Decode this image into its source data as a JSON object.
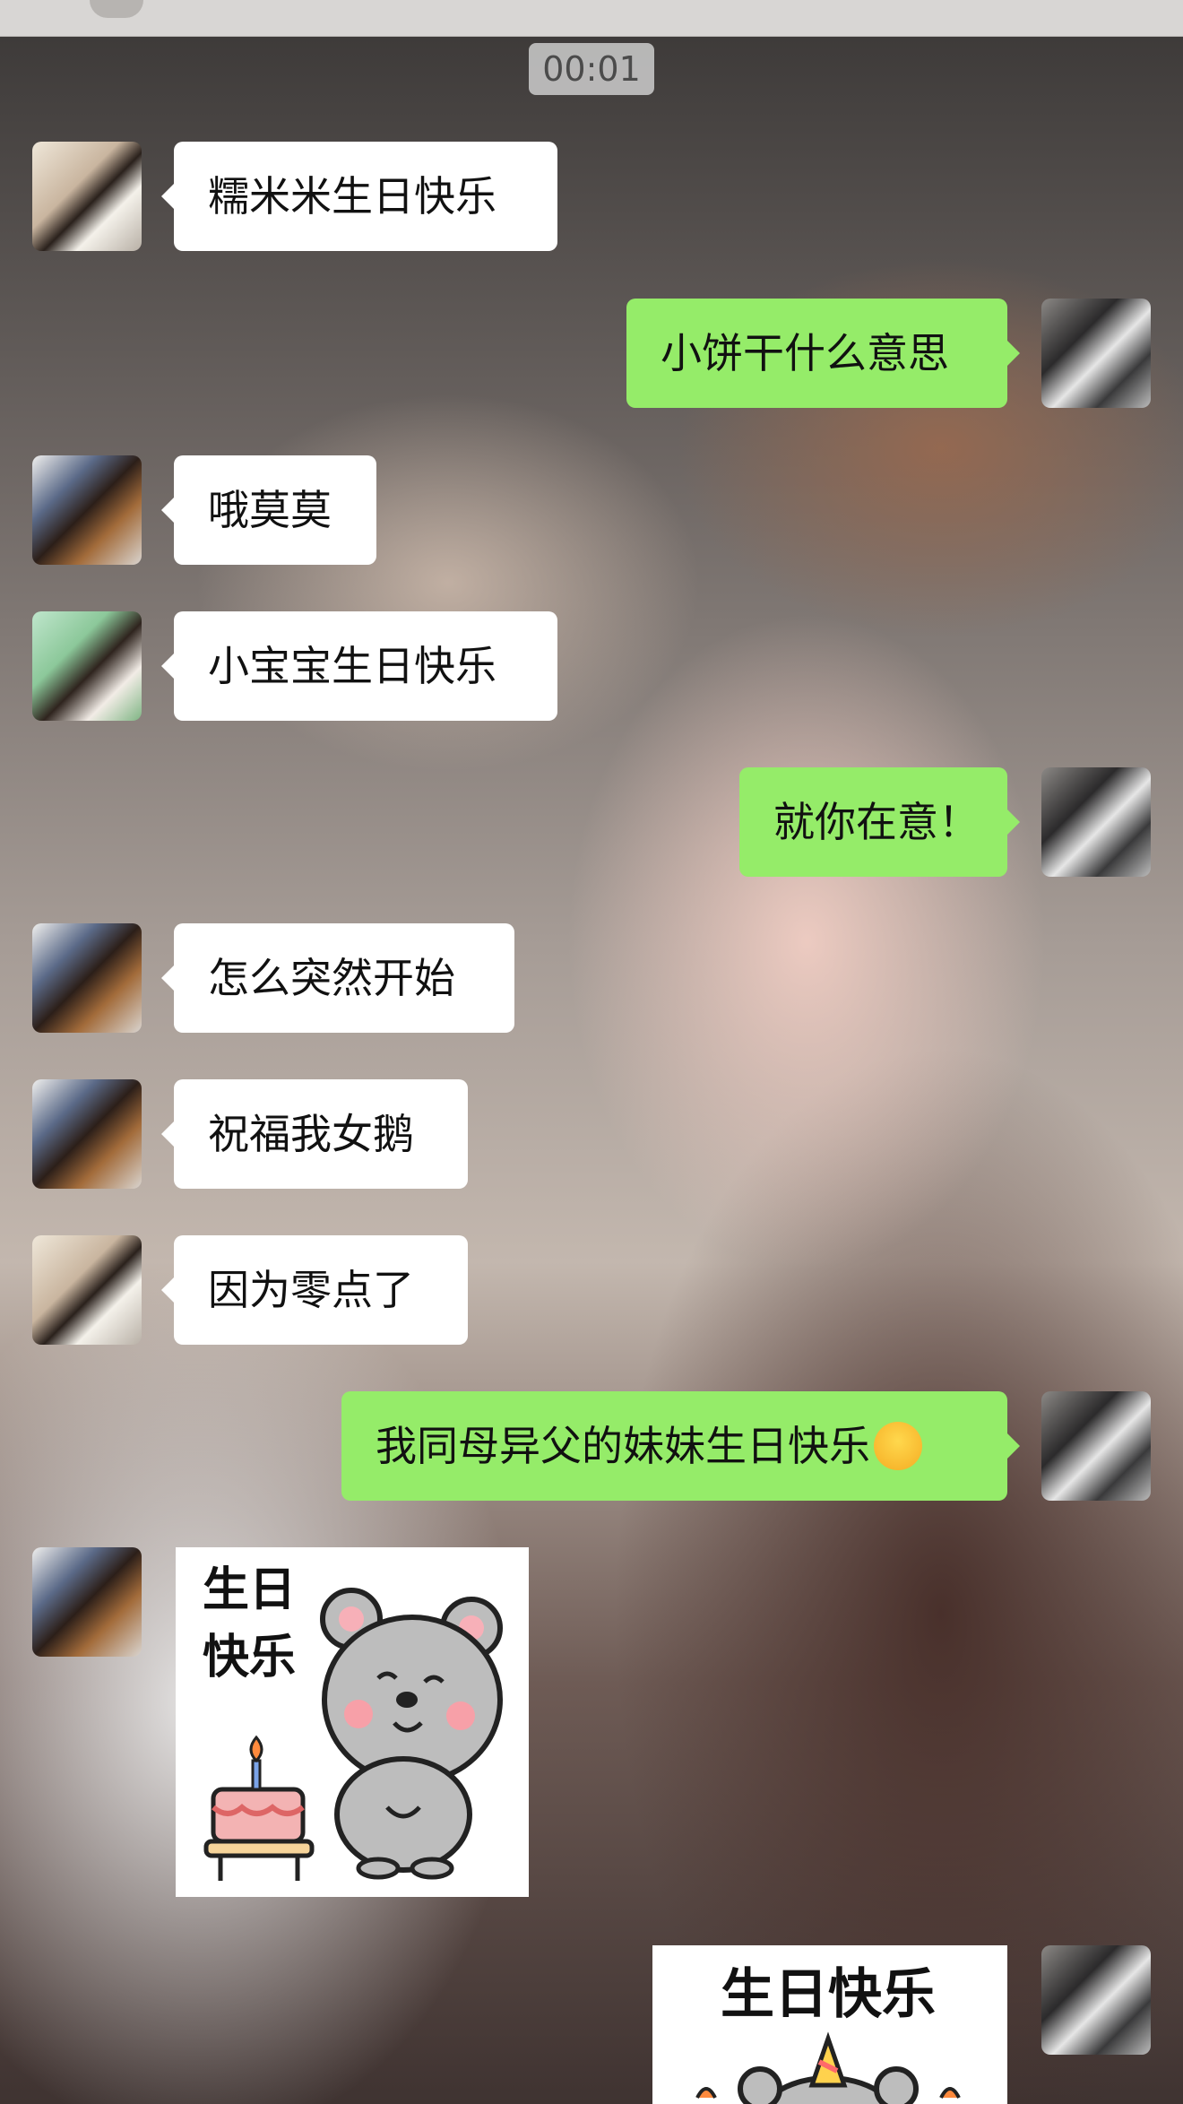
{
  "timestamp": "00:01",
  "messages": [
    {
      "side": "left",
      "text": "糯米米生日快乐",
      "avatar": "avatar-girl-white-tee"
    },
    {
      "side": "right",
      "text": "小饼干什么意思",
      "avatar": "avatar-me"
    },
    {
      "side": "left",
      "text": "哦莫莫",
      "avatar": "avatar-girl-long-hair"
    },
    {
      "side": "left",
      "text": "小宝宝生日快乐",
      "avatar": "avatar-girl-green"
    },
    {
      "side": "right",
      "text": "就你在意！",
      "avatar": "avatar-me"
    },
    {
      "side": "left",
      "text": "怎么突然开始",
      "avatar": "avatar-girl-long-hair"
    },
    {
      "side": "left",
      "text": "祝福我女鹅",
      "avatar": "avatar-girl-long-hair"
    },
    {
      "side": "left",
      "text": "因为零点了",
      "avatar": "avatar-girl-white-tee"
    },
    {
      "side": "right",
      "text": "我同母异父的妹妹生日快乐",
      "avatar": "avatar-me",
      "emoji": "blushing-face-emoji"
    },
    {
      "side": "left",
      "sticker": {
        "line1": "生日",
        "line2": "快乐",
        "icon": "mouse-with-cake-sticker"
      },
      "avatar": "avatar-girl-long-hair"
    },
    {
      "side": "right",
      "sticker": {
        "line1": "生日快乐",
        "icon": "mouse-party-hat-sticker"
      },
      "avatar": "avatar-me"
    }
  ],
  "colors": {
    "sent_bubble": "#95ec69",
    "received_bubble": "#ffffff",
    "timestamp_bg": "#cdcdcd"
  }
}
